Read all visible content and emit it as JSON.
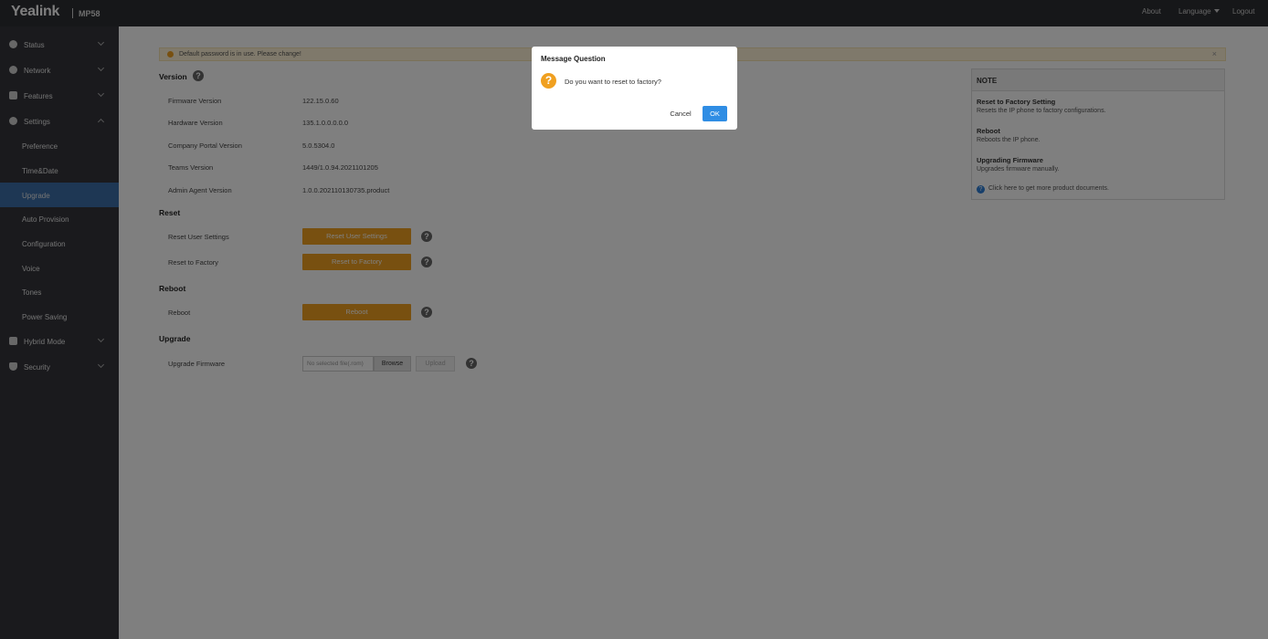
{
  "header": {
    "brand": "Yealink",
    "model": "MP58",
    "about": "About",
    "language": "Language",
    "logout": "Logout"
  },
  "sidebar": {
    "items": [
      {
        "label": "Status",
        "icon": "info-icon"
      },
      {
        "label": "Network",
        "icon": "globe-icon"
      },
      {
        "label": "Features",
        "icon": "phone-icon"
      },
      {
        "label": "Settings",
        "icon": "gear-icon"
      },
      {
        "label": "Hybrid Mode",
        "icon": "hybrid-icon"
      },
      {
        "label": "Security",
        "icon": "shield-icon"
      }
    ],
    "settings_sub": [
      "Preference",
      "Time&Date",
      "Upgrade",
      "Auto Provision",
      "Configuration",
      "Voice",
      "Tones",
      "Power Saving"
    ],
    "active": "Upgrade"
  },
  "warning": {
    "text": "Default password is in use. Please change!",
    "close": "×"
  },
  "version": {
    "title": "Version",
    "rows": [
      {
        "label": "Firmware Version",
        "value": "122.15.0.60"
      },
      {
        "label": "Hardware Version",
        "value": "135.1.0.0.0.0.0"
      },
      {
        "label": "Company Portal Version",
        "value": "5.0.5304.0"
      },
      {
        "label": "Teams Version",
        "value": "1449/1.0.94.2021101205"
      },
      {
        "label": "Admin Agent Version",
        "value": "1.0.0.202110130735.product"
      }
    ]
  },
  "reset": {
    "title": "Reset",
    "user_label": "Reset User Settings",
    "user_button": "Reset User Settings",
    "factory_label": "Reset to Factory",
    "factory_button": "Reset to Factory"
  },
  "reboot": {
    "title": "Reboot",
    "label": "Reboot",
    "button": "Reboot"
  },
  "upgrade": {
    "title": "Upgrade",
    "label": "Upgrade Firmware",
    "file_placeholder": "No selected file(.rom)",
    "browse": "Browse",
    "upload": "Upload"
  },
  "help_glyph": "?",
  "note": {
    "title": "NOTE",
    "entries": [
      {
        "title": "Reset to Factory Setting",
        "desc": "Resets the IP phone to factory configurations."
      },
      {
        "title": "Reboot",
        "desc": "Reboots the IP phone."
      },
      {
        "title": "Upgrading Firmware",
        "desc": "Upgrades firmware manually."
      }
    ],
    "link": "Click here to get more product documents."
  },
  "dialog": {
    "title": "Message Question",
    "message": "Do you want to reset to factory?",
    "cancel": "Cancel",
    "ok": "OK"
  },
  "colors": {
    "topbar": "#2d2e33",
    "sidebar": "#34353b",
    "active": "#3d6fa8",
    "orange": "#f0a020",
    "primary": "#2f8de4"
  }
}
